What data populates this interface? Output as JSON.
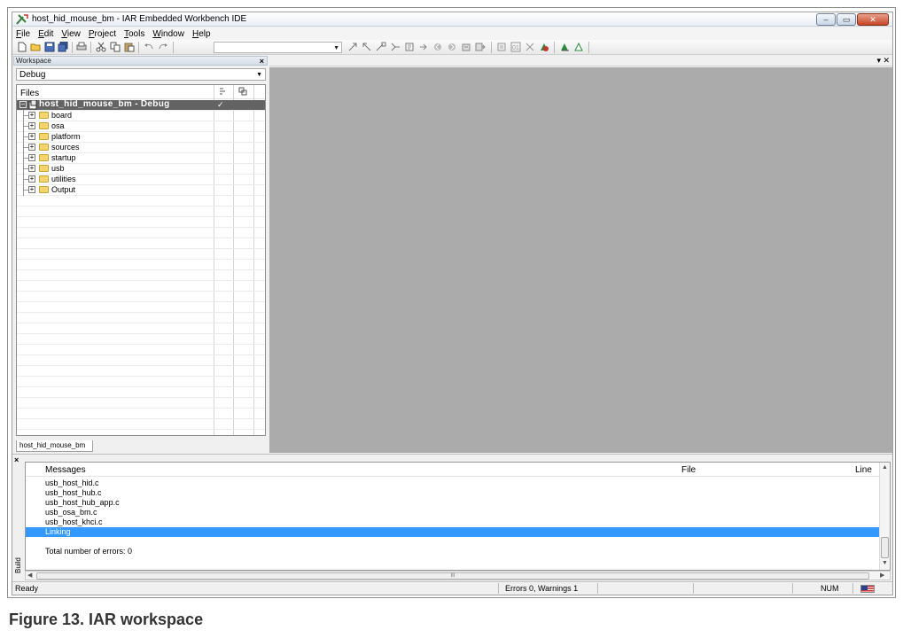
{
  "window": {
    "title": "host_hid_mouse_bm - IAR Embedded Workbench IDE",
    "minimize_glyph": "–",
    "maximize_glyph": "▭",
    "close_glyph": "✕"
  },
  "menubar": {
    "items": [
      {
        "accel": "F",
        "rest": "ile"
      },
      {
        "accel": "E",
        "rest": "dit"
      },
      {
        "accel": "V",
        "rest": "iew"
      },
      {
        "accel": "P",
        "rest": "roject"
      },
      {
        "accel": "T",
        "rest": "ools"
      },
      {
        "accel": "W",
        "rest": "indow"
      },
      {
        "accel": "H",
        "rest": "elp"
      }
    ]
  },
  "toolbar": {
    "combo_arrow": "▼",
    "icons": [
      "new-file-icon",
      "open-icon",
      "save-icon",
      "save-all-icon",
      "print-icon",
      "cut-icon",
      "copy-icon",
      "paste-icon",
      "undo-icon",
      "redo-icon"
    ]
  },
  "workspace": {
    "header_title": "Workspace",
    "close_glyph": "×",
    "configuration": "Debug",
    "dropdown_arrow": "▼",
    "files_header": "Files",
    "root": {
      "label": "host_hid_mouse_bm - Debug",
      "check": "✓"
    },
    "folders": [
      "board",
      "osa",
      "platform",
      "sources",
      "startup",
      "usb",
      "utilities",
      "Output"
    ],
    "tab_label": "host_hid_mouse_bm"
  },
  "editor": {
    "controls": "▾ ✕"
  },
  "build": {
    "close_glyph": "×",
    "side_label": "Build",
    "columns": {
      "messages": "Messages",
      "file": "File",
      "line": "Line"
    },
    "messages": [
      {
        "text": "usb_host_hid.c",
        "highlight": false
      },
      {
        "text": "usb_host_hub.c",
        "highlight": false
      },
      {
        "text": "usb_host_hub_app.c",
        "highlight": false
      },
      {
        "text": "usb_osa_bm.c",
        "highlight": false
      },
      {
        "text": "usb_host_khci.c",
        "highlight": false
      },
      {
        "text": "Linking",
        "highlight": true
      },
      {
        "text": "",
        "highlight": false
      },
      {
        "text": "Total number of errors: 0",
        "highlight": false
      }
    ],
    "hscroll_grip": "III"
  },
  "statusbar": {
    "ready": "Ready",
    "errors": "Errors 0, Warnings 1",
    "num": "NUM"
  },
  "caption": "Figure 13.  IAR workspace"
}
